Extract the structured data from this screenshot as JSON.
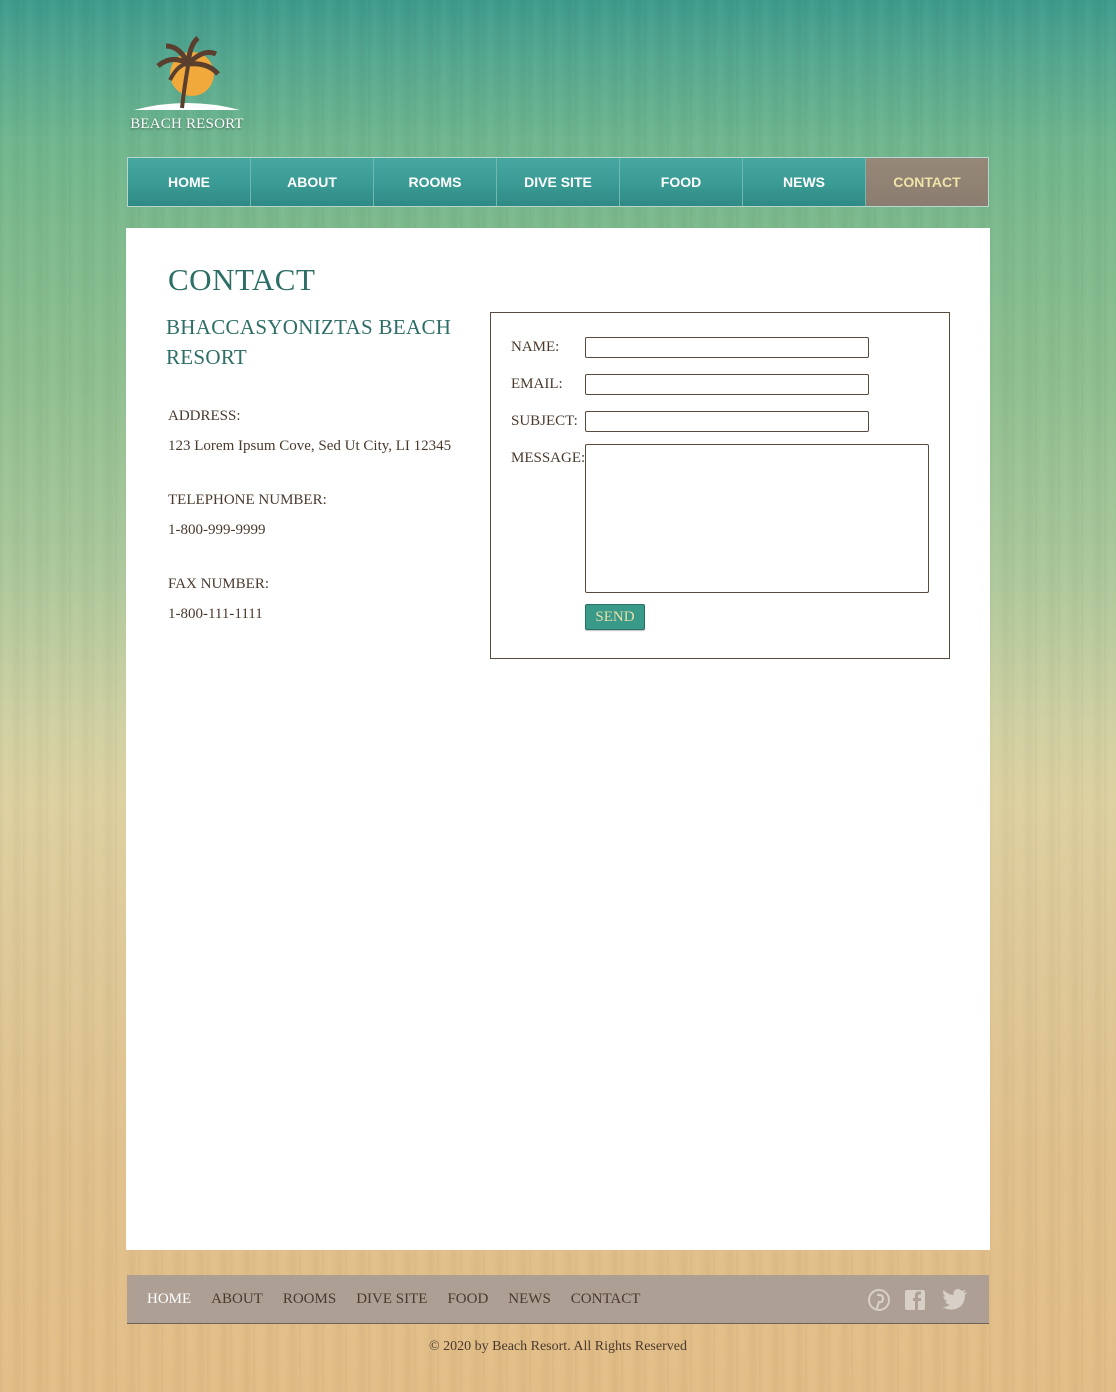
{
  "logo": {
    "text": "BEACH RESORT",
    "icon": "palm-tree-sunset-icon"
  },
  "topnav": {
    "items": [
      {
        "label": "HOME"
      },
      {
        "label": "ABOUT"
      },
      {
        "label": "ROOMS"
      },
      {
        "label": "DIVE SITE"
      },
      {
        "label": "FOOD"
      },
      {
        "label": "NEWS"
      },
      {
        "label": "CONTACT"
      }
    ],
    "active": "CONTACT"
  },
  "main": {
    "title": "CONTACT",
    "resort_name": "BHACCASYONIZTAS BEACH RESORT",
    "address_label": "ADDRESS:",
    "address_value": "123 Lorem Ipsum Cove, Sed Ut City, LI 12345",
    "phone_label": "TELEPHONE NUMBER:",
    "phone_value": "1-800-999-9999",
    "fax_label": "FAX NUMBER:",
    "fax_value": "1-800-111-1111"
  },
  "form": {
    "name_label": "NAME:",
    "name_value": "",
    "email_label": "EMAIL:",
    "email_value": "",
    "subject_label": "SUBJECT:",
    "subject_value": "",
    "message_label": "MESSAGE:",
    "message_value": "",
    "send_label": "SEND"
  },
  "footer": {
    "links": [
      {
        "label": "HOME"
      },
      {
        "label": "ABOUT"
      },
      {
        "label": "ROOMS"
      },
      {
        "label": "DIVE SITE"
      },
      {
        "label": "FOOD"
      },
      {
        "label": "NEWS"
      },
      {
        "label": "CONTACT"
      }
    ],
    "active": "HOME",
    "social": [
      "pinterest-icon",
      "facebook-icon",
      "twitter-icon"
    ],
    "copyright": "© 2020 by Beach Resort. All Rights Reserved"
  },
  "colors": {
    "accent_teal": "#3a9a94",
    "heading_teal": "#2d6e66",
    "active_nav": "#8a7d6f",
    "footer_bar": "#ad9f93",
    "text_brown": "#4a3a2e"
  }
}
